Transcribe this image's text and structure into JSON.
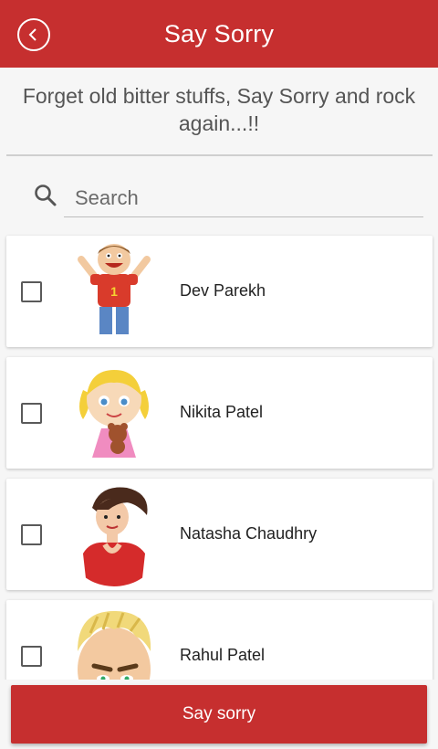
{
  "appbar": {
    "title": "Say Sorry",
    "back_icon": "chevron-left-icon"
  },
  "tagline": "Forget old bitter stuffs, Say Sorry and rock again...!!",
  "search": {
    "placeholder": "Search",
    "value": "",
    "icon": "search-icon"
  },
  "contacts": [
    {
      "name": "Dev Parekh",
      "checked": false,
      "avatar": "boy-cartoon"
    },
    {
      "name": "Nikita Patel",
      "checked": false,
      "avatar": "girl-with-teddy-cartoon"
    },
    {
      "name": "Natasha Chaudhry",
      "checked": false,
      "avatar": "woman-red-top-cartoon"
    },
    {
      "name": "Rahul Patel",
      "checked": false,
      "avatar": "blond-man-cartoon"
    }
  ],
  "action_button": {
    "label": "Say sorry"
  },
  "colors": {
    "primary": "#c62f2f",
    "background": "#f6f6f6",
    "card": "#ffffff"
  }
}
